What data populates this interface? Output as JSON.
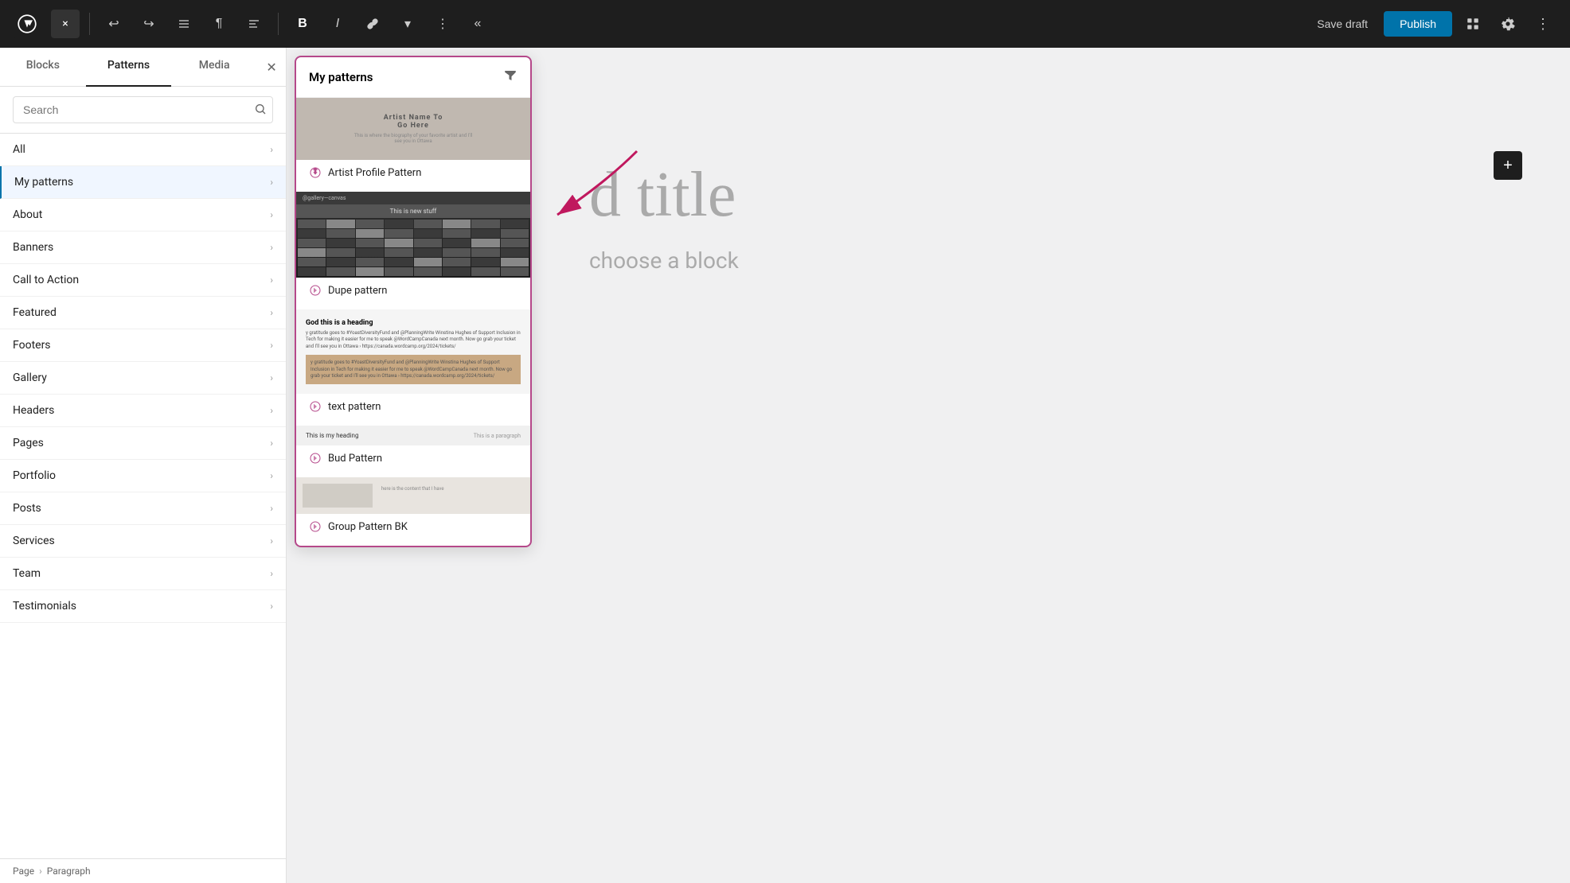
{
  "toolbar": {
    "logo_label": "WordPress",
    "close_label": "×",
    "undo_label": "↩",
    "redo_label": "↪",
    "list_view_label": "≡",
    "paragraph_label": "¶",
    "align_label": "≡",
    "bold_label": "B",
    "italic_label": "I",
    "link_label": "🔗",
    "more_label": "⋮",
    "collapse_label": "«",
    "save_draft_label": "Save draft",
    "publish_label": "Publish",
    "view_label": "⬜",
    "settings_label": "⊞",
    "overflow_label": "⋮"
  },
  "sidebar": {
    "tabs": [
      {
        "id": "blocks",
        "label": "Blocks"
      },
      {
        "id": "patterns",
        "label": "Patterns"
      },
      {
        "id": "media",
        "label": "Media"
      }
    ],
    "active_tab": "patterns",
    "search": {
      "placeholder": "Search",
      "value": ""
    },
    "nav_items": [
      {
        "id": "all",
        "label": "All",
        "active": false
      },
      {
        "id": "my-patterns",
        "label": "My patterns",
        "active": true
      },
      {
        "id": "about",
        "label": "About",
        "active": false
      },
      {
        "id": "banners",
        "label": "Banners",
        "active": false
      },
      {
        "id": "call-to-action",
        "label": "Call to Action",
        "active": false
      },
      {
        "id": "featured",
        "label": "Featured",
        "active": false
      },
      {
        "id": "footers",
        "label": "Footers",
        "active": false
      },
      {
        "id": "gallery",
        "label": "Gallery",
        "active": false
      },
      {
        "id": "headers",
        "label": "Headers",
        "active": false
      },
      {
        "id": "pages",
        "label": "Pages",
        "active": false
      },
      {
        "id": "portfolio",
        "label": "Portfolio",
        "active": false
      },
      {
        "id": "posts",
        "label": "Posts",
        "active": false
      },
      {
        "id": "services",
        "label": "Services",
        "active": false
      },
      {
        "id": "team",
        "label": "Team",
        "active": false
      },
      {
        "id": "testimonials",
        "label": "Testimonials",
        "active": false
      }
    ]
  },
  "breadcrumb": {
    "items": [
      "Page",
      "Paragraph"
    ]
  },
  "patterns_panel": {
    "title": "My patterns",
    "patterns": [
      {
        "id": "artist-profile",
        "label": "Artist Profile Pattern",
        "preview_type": "artist"
      },
      {
        "id": "dupe-pattern",
        "label": "Dupe pattern",
        "preview_type": "dupe"
      },
      {
        "id": "text-pattern",
        "label": "text pattern",
        "preview_type": "text"
      },
      {
        "id": "bud-pattern",
        "label": "Bud Pattern",
        "preview_type": "bud"
      },
      {
        "id": "group-pattern-bk",
        "label": "Group Pattern BK",
        "preview_type": "group"
      }
    ]
  },
  "canvas": {
    "title": "d title",
    "subtitle": "choose a block"
  }
}
